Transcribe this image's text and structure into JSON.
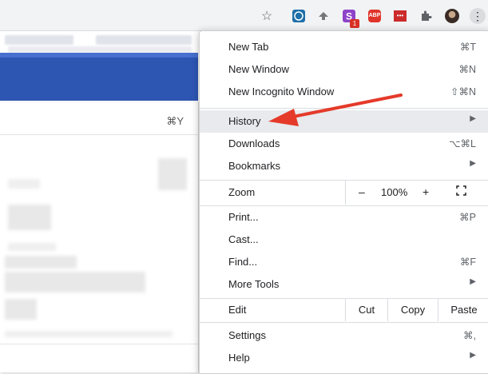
{
  "toolbar": {
    "star": "☆",
    "ext_badge_count": "1",
    "abp_label": "ABP",
    "ext_dots": "•••",
    "more": "⋮"
  },
  "submenu": {
    "history_shortcut": "⌘Y"
  },
  "menu": {
    "new_tab": {
      "label": "New Tab",
      "shortcut": "⌘T"
    },
    "new_window": {
      "label": "New Window",
      "shortcut": "⌘N"
    },
    "new_incognito": {
      "label": "New Incognito Window",
      "shortcut": "⇧⌘N"
    },
    "history": {
      "label": "History"
    },
    "downloads": {
      "label": "Downloads",
      "shortcut": "⌥⌘L"
    },
    "bookmarks": {
      "label": "Bookmarks"
    },
    "zoom": {
      "label": "Zoom",
      "minus": "–",
      "value": "100%",
      "plus": "+"
    },
    "print": {
      "label": "Print...",
      "shortcut": "⌘P"
    },
    "cast": {
      "label": "Cast..."
    },
    "find": {
      "label": "Find...",
      "shortcut": "⌘F"
    },
    "more_tools": {
      "label": "More Tools"
    },
    "edit": {
      "label": "Edit",
      "cut": "Cut",
      "copy": "Copy",
      "paste": "Paste"
    },
    "settings": {
      "label": "Settings",
      "shortcut": "⌘,"
    },
    "help": {
      "label": "Help"
    },
    "submenu_arrow": "▶"
  },
  "colors": {
    "arrow": "#e53a2a",
    "page_header_blue": "#2d56b3"
  }
}
